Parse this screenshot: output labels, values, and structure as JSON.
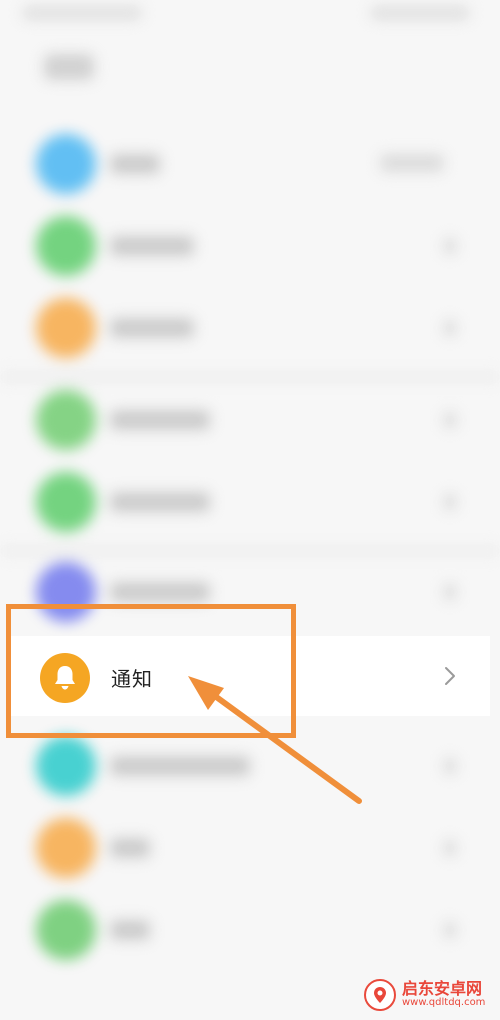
{
  "settings_row": {
    "label": "通知",
    "icon": "bell-icon",
    "icon_color": "#f5a623"
  },
  "blurred_row_icon_colors": [
    "#5bbdf3",
    "#6ed27a",
    "#f7b25a",
    "#7fd27f",
    "#6ed27a",
    "#7f86ef",
    "#3fcfcf",
    "#f7b25a",
    "#79cf7c"
  ],
  "annotation": {
    "color": "#f08f3a"
  },
  "watermark": {
    "title": "启东安卓网",
    "url": "www.qdltdq.com",
    "color": "#e9473a"
  }
}
